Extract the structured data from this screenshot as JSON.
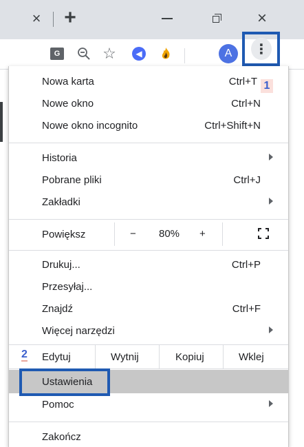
{
  "titlebar": {
    "tab_close_glyph": "×",
    "new_tab_glyph": "+",
    "window_close_glyph": "×"
  },
  "toolbar": {
    "translate_glyph": "G",
    "zoom_glyph": "⊖",
    "star_glyph": "☆",
    "extension_glyph": "◀",
    "extension2_glyph": "🔥",
    "avatar_letter": "A",
    "menu_glyph": "⋮"
  },
  "menu": {
    "new_tab": {
      "label": "Nowa karta",
      "shortcut": "Ctrl+T"
    },
    "badge1": "1",
    "new_window": {
      "label": "Nowe okno",
      "shortcut": "Ctrl+N"
    },
    "incognito": {
      "label": "Nowe okno incognito",
      "shortcut": "Ctrl+Shift+N"
    },
    "history": {
      "label": "Historia"
    },
    "downloads": {
      "label": "Pobrane pliki",
      "shortcut": "Ctrl+J"
    },
    "bookmarks": {
      "label": "Zakładki"
    },
    "zoom": {
      "label": "Powiększ",
      "minus": "−",
      "value": "80%",
      "plus": "+"
    },
    "print": {
      "label": "Drukuj...",
      "shortcut": "Ctrl+P"
    },
    "cast": {
      "label": "Przesyłaj..."
    },
    "find": {
      "label": "Znajdź",
      "shortcut": "Ctrl+F"
    },
    "more_tools": {
      "label": "Więcej narzędzi"
    },
    "edit": {
      "number": "2",
      "label": "Edytuj",
      "cut": "Wytnij",
      "copy": "Kopiuj",
      "paste": "Wklej"
    },
    "settings": {
      "label": "Ustawienia"
    },
    "help": {
      "label": "Pomoc"
    },
    "exit": {
      "label": "Zakończ"
    }
  },
  "colors": {
    "titlebar_bg": "#dee1e6",
    "highlight_box": "#1f5ab2",
    "selected_row": "#c7c7c7",
    "avatar": "#4d72e3"
  }
}
